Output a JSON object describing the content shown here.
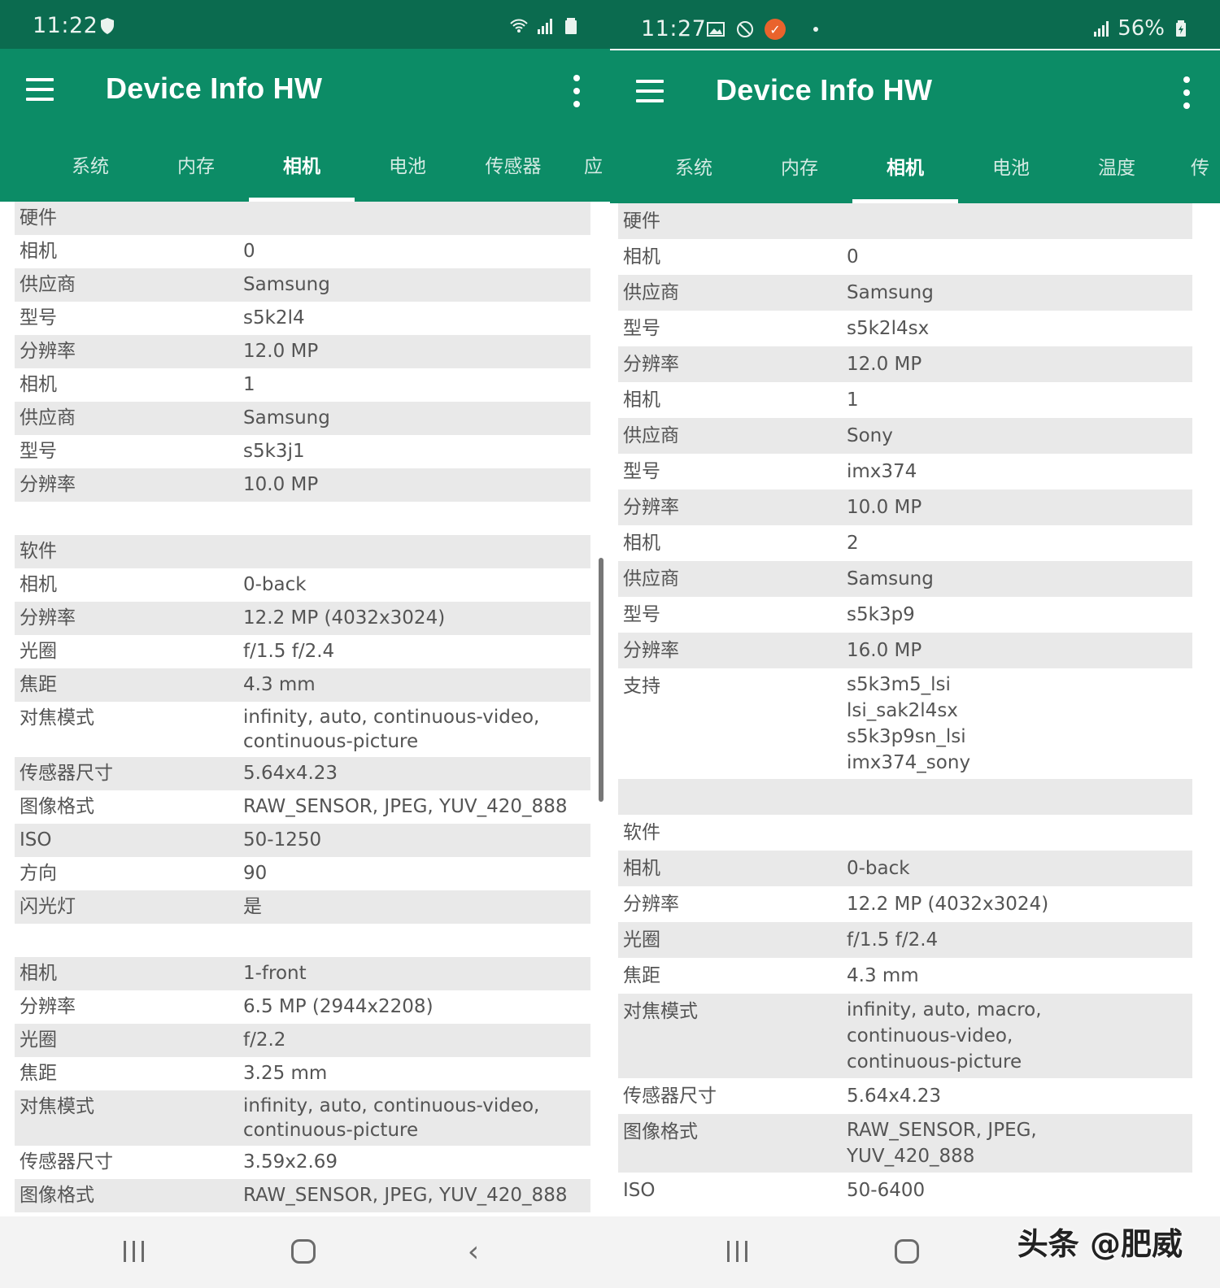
{
  "left": {
    "status": {
      "time": "11:22"
    },
    "app_bar": {
      "title": "Device Info HW"
    },
    "tabs": [
      "系统",
      "内存",
      "相机",
      "电池",
      "传感器",
      "应"
    ],
    "active_tab": 2,
    "rows": [
      {
        "k": "硬件",
        "v": ""
      },
      {
        "k": "相机",
        "v": "0"
      },
      {
        "k": "供应商",
        "v": "Samsung"
      },
      {
        "k": "型号",
        "v": "s5k2l4"
      },
      {
        "k": "分辨率",
        "v": "12.0 MP"
      },
      {
        "k": "相机",
        "v": "1"
      },
      {
        "k": "供应商",
        "v": "Samsung"
      },
      {
        "k": "型号",
        "v": "s5k3j1"
      },
      {
        "k": "分辨率",
        "v": "10.0 MP"
      },
      {
        "k": "",
        "v": ""
      },
      {
        "k": "软件",
        "v": ""
      },
      {
        "k": "相机",
        "v": "0-back"
      },
      {
        "k": "分辨率",
        "v": "12.2 MP (4032x3024)"
      },
      {
        "k": "光圈",
        "v": "f/1.5 f/2.4"
      },
      {
        "k": "焦距",
        "v": "4.3 mm"
      },
      {
        "k": "对焦模式",
        "v": "infinity, auto, continuous-video,\ncontinuous-picture"
      },
      {
        "k": "传感器尺寸",
        "v": "5.64x4.23"
      },
      {
        "k": "图像格式",
        "v": "RAW_SENSOR, JPEG, YUV_420_888"
      },
      {
        "k": "ISO",
        "v": "50-1250"
      },
      {
        "k": "方向",
        "v": "90"
      },
      {
        "k": "闪光灯",
        "v": "是"
      },
      {
        "k": "",
        "v": ""
      },
      {
        "k": "相机",
        "v": "1-front"
      },
      {
        "k": "分辨率",
        "v": "6.5 MP (2944x2208)"
      },
      {
        "k": "光圈",
        "v": "f/2.2"
      },
      {
        "k": "焦距",
        "v": "3.25 mm"
      },
      {
        "k": "对焦模式",
        "v": "infinity, auto, continuous-video,\ncontinuous-picture"
      },
      {
        "k": "传感器尺寸",
        "v": "3.59x2.69"
      },
      {
        "k": "图像格式",
        "v": "RAW_SENSOR, JPEG, YUV_420_888"
      }
    ]
  },
  "right": {
    "status": {
      "time": "11:27",
      "battery": "56%"
    },
    "app_bar": {
      "title": "Device Info HW"
    },
    "tabs": [
      "系统",
      "内存",
      "相机",
      "电池",
      "温度",
      "传"
    ],
    "active_tab": 2,
    "rows": [
      {
        "k": "硬件",
        "v": ""
      },
      {
        "k": "相机",
        "v": "0"
      },
      {
        "k": "供应商",
        "v": "Samsung"
      },
      {
        "k": "型号",
        "v": "s5k2l4sx"
      },
      {
        "k": "分辨率",
        "v": "12.0 MP"
      },
      {
        "k": "相机",
        "v": "1"
      },
      {
        "k": "供应商",
        "v": "Sony"
      },
      {
        "k": "型号",
        "v": "imx374"
      },
      {
        "k": "分辨率",
        "v": "10.0 MP"
      },
      {
        "k": "相机",
        "v": "2"
      },
      {
        "k": "供应商",
        "v": "Samsung"
      },
      {
        "k": "型号",
        "v": "s5k3p9"
      },
      {
        "k": "分辨率",
        "v": "16.0 MP"
      },
      {
        "k": "支持",
        "v": "s5k3m5_lsi\nlsi_sak2l4sx\ns5k3p9sn_lsi\nimx374_sony"
      },
      {
        "k": "",
        "v": ""
      },
      {
        "k": "软件",
        "v": ""
      },
      {
        "k": "相机",
        "v": "0-back"
      },
      {
        "k": "分辨率",
        "v": "12.2 MP (4032x3024)"
      },
      {
        "k": "光圈",
        "v": "f/1.5 f/2.4"
      },
      {
        "k": "焦距",
        "v": "4.3 mm"
      },
      {
        "k": "对焦模式",
        "v": "infinity, auto, macro,\ncontinuous-video,\ncontinuous-picture"
      },
      {
        "k": "传感器尺寸",
        "v": "5.64x4.23"
      },
      {
        "k": "图像格式",
        "v": "RAW_SENSOR, JPEG,\nYUV_420_888"
      },
      {
        "k": "ISO",
        "v": "50-6400"
      }
    ]
  },
  "watermark": "头条 @肥威",
  "colors": {
    "status_bar": "#0b6b4f",
    "app_bar": "#0c8c66",
    "row_alt": "#e9e9e9",
    "text": "#545454"
  }
}
